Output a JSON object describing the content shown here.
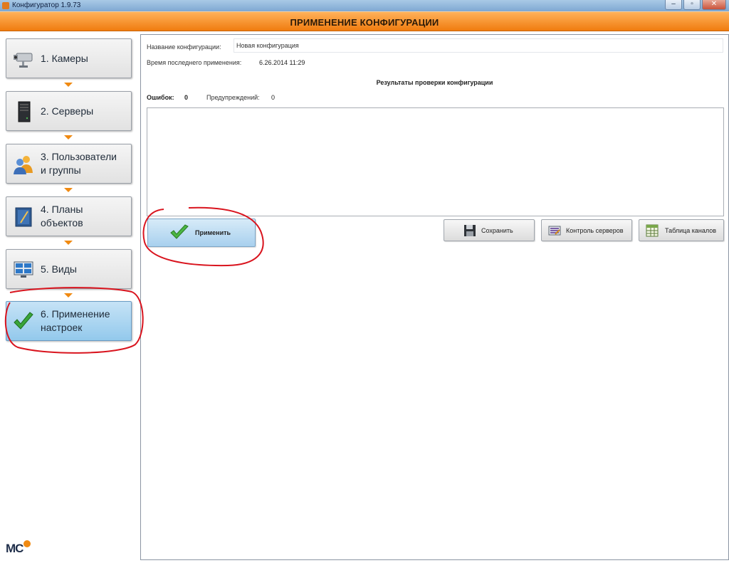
{
  "window": {
    "title": "Конфигуратор 1.9.73",
    "controls": [
      "minimize-icon",
      "restore-icon",
      "close-icon"
    ]
  },
  "header": {
    "title": "ПРИМЕНЕНИЕ КОНФИГУРАЦИИ"
  },
  "sidebar": {
    "steps": [
      {
        "label": "1. Камеры",
        "icon": "camera-icon",
        "active": false
      },
      {
        "label": "2. Серверы",
        "icon": "server-icon",
        "active": false
      },
      {
        "label": "3. Пользователи\nи группы",
        "icon": "users-icon",
        "active": false
      },
      {
        "label": "4. Планы\nобъектов",
        "icon": "floor-plan-icon",
        "active": false
      },
      {
        "label": "5. Виды",
        "icon": "monitor-layout-icon",
        "active": false
      },
      {
        "label": "6. Применение\nнастроек",
        "icon": "checkmark-icon",
        "active": true
      }
    ],
    "logo_text": "MC"
  },
  "main": {
    "config_name_label": "Название конфигурации:",
    "config_name_value": "Новая конфигурация",
    "last_apply_label": "Время последнего применения:",
    "last_apply_value": "6.26.2014 11:29",
    "results_title": "Результаты проверки конфигурации",
    "errors_label": "Ошибок:",
    "errors_count": "0",
    "warnings_label": "Предупреждений:",
    "warnings_count": "0",
    "buttons": {
      "apply": "Применить",
      "save": "Сохранить",
      "server_control": "Контроль серверов",
      "channels_table": "Таблица каналов"
    }
  },
  "colors": {
    "header_orange": "#f07c0f",
    "active_step_blue": "#93c9ec",
    "annotation_red": "#d9141e",
    "arrow_orange": "#f08a12"
  }
}
